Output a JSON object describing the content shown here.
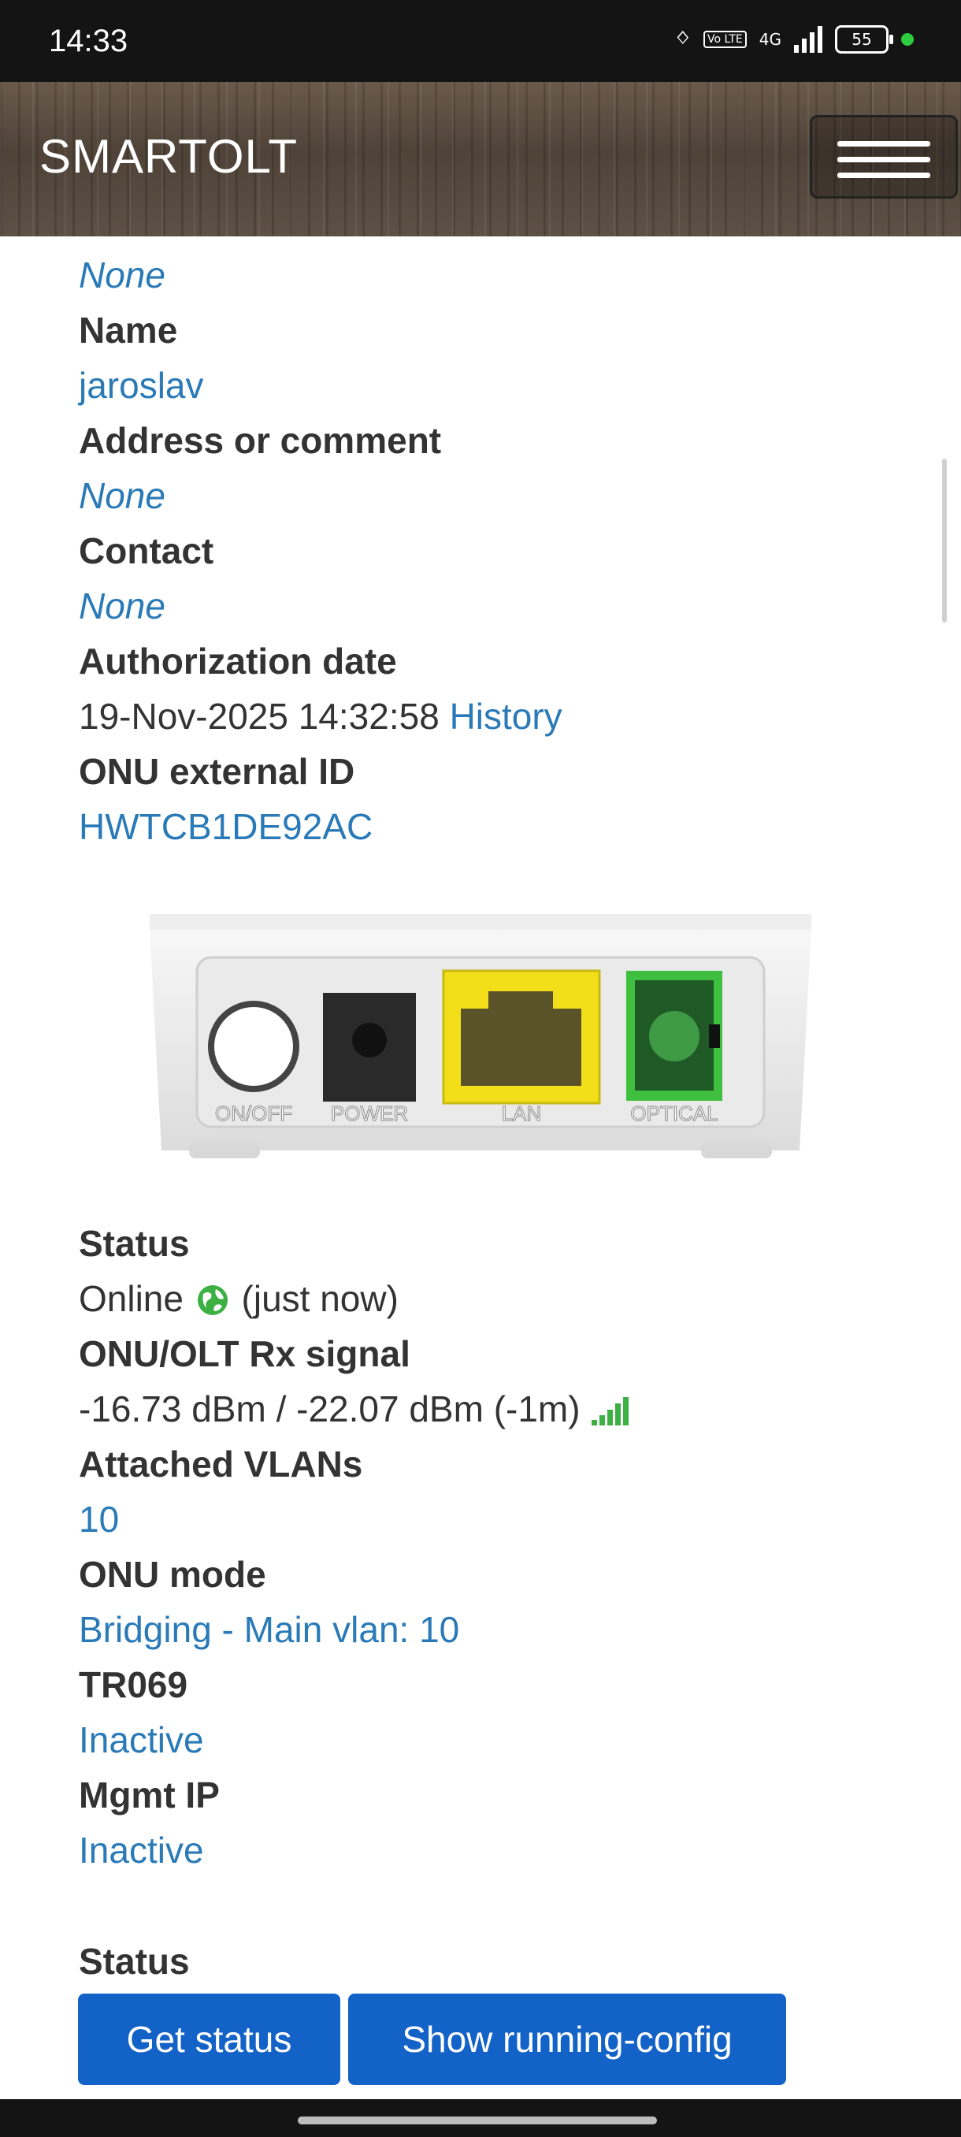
{
  "status_bar": {
    "time": "14:33",
    "battery": "55",
    "network": "4G",
    "volte": "Vo LTE"
  },
  "navbar": {
    "brand": "SMARTOLT"
  },
  "fields": {
    "top_value": "None",
    "name_label": "Name",
    "name_value": "jaroslav",
    "address_label": "Address or comment",
    "address_value": "None",
    "contact_label": "Contact",
    "contact_value": "None",
    "auth_label": "Authorization date",
    "auth_value": "19-Nov-2025 14:32:58",
    "auth_history": "History",
    "ext_id_label": "ONU external ID",
    "ext_id_value": "HWTCB1DE92AC",
    "status_label": "Status",
    "status_online": "Online",
    "status_time": "(just now)",
    "rx_label": "ONU/OLT Rx signal",
    "rx_value": "-16.73 dBm / -22.07 dBm (-1m)",
    "vlans_label": "Attached VLANs",
    "vlans_value": "10",
    "mode_label": "ONU mode",
    "mode_value": "Bridging - Main vlan: 10",
    "tr069_label": "TR069",
    "tr069_value": "Inactive",
    "mgmt_label": "Mgmt IP",
    "mgmt_value": "Inactive",
    "status2_label": "Status"
  },
  "device": {
    "ports": [
      "ON/OFF",
      "POWER",
      "LAN",
      "OPTICAL"
    ]
  },
  "buttons": {
    "get_status": "Get status",
    "running_config": "Show running-config"
  },
  "colors": {
    "link": "#2a7ab8",
    "button": "#1262c7",
    "online": "#3cb043",
    "lan_port": "#f2df1a",
    "optical_port": "#3fbf3f"
  }
}
